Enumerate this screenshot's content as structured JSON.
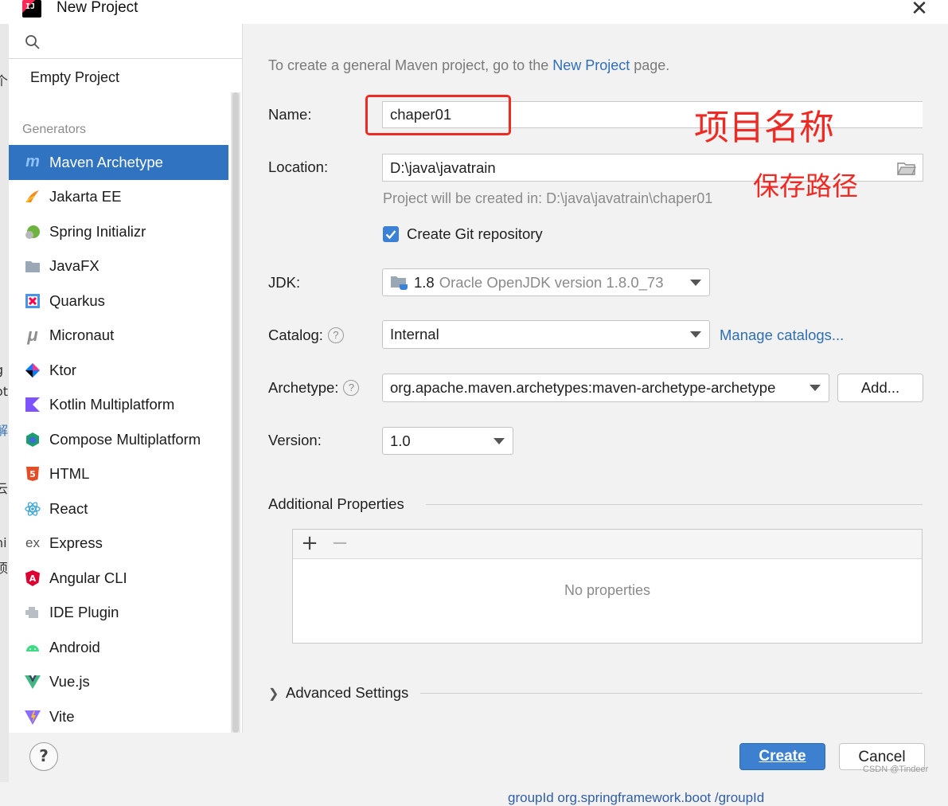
{
  "window": {
    "title": "New Project"
  },
  "sidebar": {
    "empty_project": "Empty Project",
    "generators_label": "Generators",
    "items": [
      {
        "label": "Maven Archetype",
        "icon": "maven-icon",
        "selected": true
      },
      {
        "label": "Jakarta EE",
        "icon": "jakarta-ee-icon"
      },
      {
        "label": "Spring Initializr",
        "icon": "spring-icon"
      },
      {
        "label": "JavaFX",
        "icon": "javafx-icon"
      },
      {
        "label": "Quarkus",
        "icon": "quarkus-icon"
      },
      {
        "label": "Micronaut",
        "icon": "micronaut-icon"
      },
      {
        "label": "Ktor",
        "icon": "ktor-icon"
      },
      {
        "label": "Kotlin Multiplatform",
        "icon": "kotlin-icon"
      },
      {
        "label": "Compose Multiplatform",
        "icon": "compose-icon"
      },
      {
        "label": "HTML",
        "icon": "html5-icon"
      },
      {
        "label": "React",
        "icon": "react-icon"
      },
      {
        "label": "Express",
        "icon": "express-icon"
      },
      {
        "label": "Angular CLI",
        "icon": "angular-icon"
      },
      {
        "label": "IDE Plugin",
        "icon": "ide-plugin-icon"
      },
      {
        "label": "Android",
        "icon": "android-icon"
      },
      {
        "label": "Vue.js",
        "icon": "vue-icon"
      },
      {
        "label": "Vite",
        "icon": "vite-icon"
      }
    ]
  },
  "main": {
    "info_prefix": "To create a general Maven project, go to the ",
    "info_link": "New Project",
    "info_suffix": " page.",
    "name_label": "Name:",
    "name_value": "chaper01",
    "location_label": "Location:",
    "location_value": "D:\\java\\javatrain",
    "location_hint": "Project will be created in: D:\\java\\javatrain\\chaper01",
    "git_label": "Create Git repository",
    "git_checked": true,
    "jdk_label": "JDK:",
    "jdk_version": "1.8",
    "jdk_desc": "Oracle OpenJDK version 1.8.0_73",
    "catalog_label": "Catalog:",
    "catalog_value": "Internal",
    "manage_catalogs": "Manage catalogs...",
    "archetype_label": "Archetype:",
    "archetype_value": "org.apache.maven.archetypes:maven-archetype-archetype",
    "add_button": "Add...",
    "version_label": "Version:",
    "version_value": "1.0",
    "additional_properties": "Additional Properties",
    "add_symbol": "+",
    "remove_symbol": "−",
    "no_properties": "No properties",
    "advanced_settings": "Advanced Settings"
  },
  "footer": {
    "create": "Create",
    "cancel": "Cancel",
    "help": "?"
  },
  "annotations": {
    "name_note": "项目名称",
    "location_note": "保存路径"
  },
  "watermark": "CSDN @Tindeer",
  "background_peek": "groupId  org.springframework.boot  /groupId"
}
